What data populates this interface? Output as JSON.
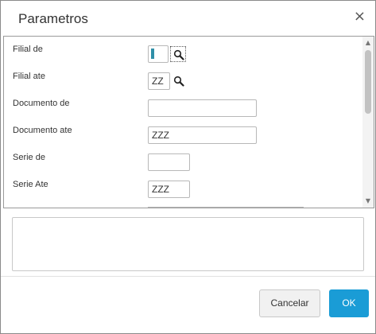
{
  "dialog": {
    "title": "Parametros",
    "close_glyph": "×"
  },
  "params": {
    "rows": [
      {
        "label": "Filial de",
        "value": "",
        "has_lookup": true
      },
      {
        "label": "Filial ate",
        "value": "ZZ",
        "has_lookup": true
      },
      {
        "label": "Documento de",
        "value": "",
        "has_lookup": false
      },
      {
        "label": "Documento ate",
        "value": "ZZZ",
        "has_lookup": false
      },
      {
        "label": "Serie de",
        "value": "",
        "has_lookup": false
      },
      {
        "label": "Serie Ate",
        "value": "ZZZ",
        "has_lookup": false
      }
    ]
  },
  "icons": {
    "lookup": "magnifier-icon",
    "close": "close-icon",
    "scroll_up": "arrow-up-icon",
    "scroll_down": "arrow-down-icon"
  },
  "colors": {
    "primary_button": "#1a9cd6",
    "caret": "#2f8fa8"
  },
  "footer": {
    "cancel_label": "Cancelar",
    "ok_label": "OK"
  }
}
